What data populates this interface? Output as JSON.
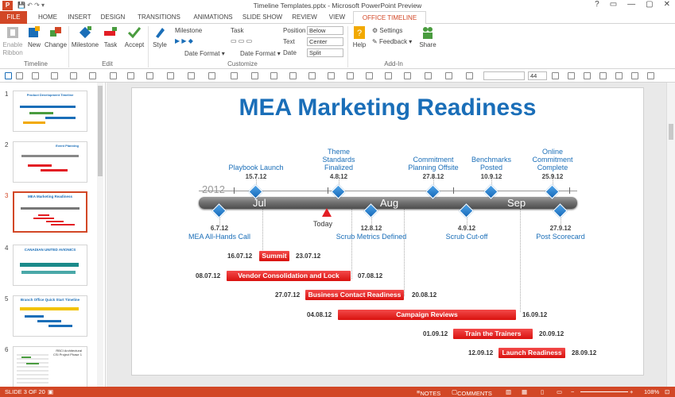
{
  "window": {
    "title": "Timeline Templates.pptx - Microsoft PowerPoint Preview",
    "app_icon": "P",
    "controls": [
      "?",
      "▭",
      "—",
      "▢",
      "✕"
    ]
  },
  "tabs": [
    "FILE",
    "HOME",
    "INSERT",
    "DESIGN",
    "TRANSITIONS",
    "ANIMATIONS",
    "SLIDE SHOW",
    "REVIEW",
    "VIEW",
    "OFFICE TIMELINE PLUS"
  ],
  "ribbon": {
    "timeline_group": {
      "label": "Timeline",
      "buttons": [
        "Enable Ribbon",
        "New",
        "Change"
      ]
    },
    "edit_group": {
      "label": "Edit",
      "buttons": [
        "Milestone",
        "Task",
        "Accept"
      ]
    },
    "customize_group": {
      "label": "Customize",
      "style": "Style",
      "milestone": "Milestone",
      "milestone_date_format": "Date Format",
      "task": "Task",
      "task_date_format": "Date Format",
      "position_label": "Position",
      "position_value": "Below",
      "text_label": "Text",
      "text_value": "Center",
      "date_label": "Date",
      "date_value": "Split"
    },
    "addin_group": {
      "label": "Add-In",
      "help": "Help",
      "settings": "Settings",
      "feedback": "Feedback",
      "share": "Share"
    }
  },
  "format_bar": {
    "font_size": "44"
  },
  "thumbnails": [
    {
      "num": "1",
      "title": "Product Development Timeline"
    },
    {
      "num": "2",
      "title": "Event Planning"
    },
    {
      "num": "3",
      "title": "MEA Marketing Readiness"
    },
    {
      "num": "4",
      "title": "CANADIAN UNITED AVIONICS"
    },
    {
      "num": "5",
      "title": "Branch Office Quick Start Timeline"
    },
    {
      "num": "6",
      "title": "RBCI Architectural CSI Project Phase 1"
    }
  ],
  "slide": {
    "title": "MEA Marketing Readiness",
    "year": "2012",
    "months": [
      "Jul",
      "Aug",
      "Sep"
    ],
    "today": "Today",
    "milestones_above": [
      {
        "date": "15.7.12",
        "label": "Playbook Launch"
      },
      {
        "date": "4.8.12",
        "label": "Theme Standards Finalized"
      },
      {
        "date": "27.8.12",
        "label": "Commitment Planning Offsite"
      },
      {
        "date": "10.9.12",
        "label": "Benchmarks Posted"
      },
      {
        "date": "25.9.12",
        "label": "Online Commitment Complete"
      }
    ],
    "milestones_below": [
      {
        "date": "6.7.12",
        "label": "MEA All-Hands Call"
      },
      {
        "date": "12.8.12",
        "label": "Scrub Metrics Defined"
      },
      {
        "date": "4.9.12",
        "label": "Scrub Cut-off"
      },
      {
        "date": "27.9.12",
        "label": "Post Scorecard"
      }
    ],
    "tasks": [
      {
        "start": "16.07.12",
        "name": "Summit",
        "end": "23.07.12"
      },
      {
        "start": "08.07.12",
        "name": "Vendor Consolidation and Lock",
        "end": "07.08.12"
      },
      {
        "start": "27.07.12",
        "name": "Business Contact Readiness",
        "end": "20.08.12"
      },
      {
        "start": "04.08.12",
        "name": "Campaign Reviews",
        "end": "16.09.12"
      },
      {
        "start": "01.09.12",
        "name": "Train the Trainers",
        "end": "20.09.12"
      },
      {
        "start": "12.09.12",
        "name": "Launch Readiness",
        "end": "28.09.12"
      }
    ]
  },
  "status": {
    "slide": "SLIDE 3 OF 20",
    "notes": "NOTES",
    "comments": "COMMENTS",
    "zoom": "108%"
  }
}
